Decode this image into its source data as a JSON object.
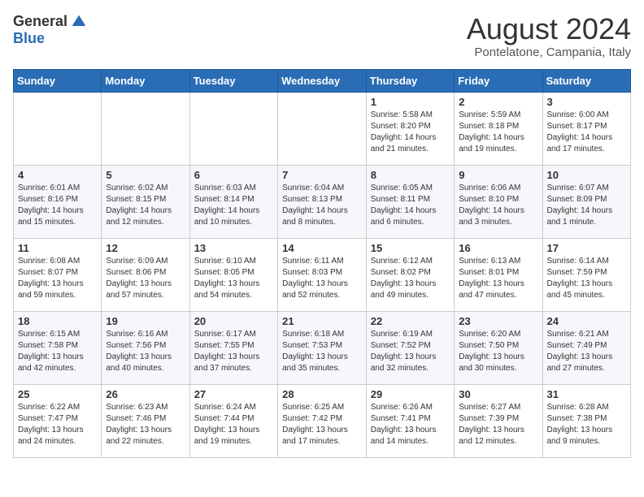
{
  "logo": {
    "general": "General",
    "blue": "Blue"
  },
  "title": "August 2024",
  "subtitle": "Pontelatone, Campania, Italy",
  "days_of_week": [
    "Sunday",
    "Monday",
    "Tuesday",
    "Wednesday",
    "Thursday",
    "Friday",
    "Saturday"
  ],
  "weeks": [
    [
      {
        "day": "",
        "info": ""
      },
      {
        "day": "",
        "info": ""
      },
      {
        "day": "",
        "info": ""
      },
      {
        "day": "",
        "info": ""
      },
      {
        "day": "1",
        "info": "Sunrise: 5:58 AM\nSunset: 8:20 PM\nDaylight: 14 hours\nand 21 minutes."
      },
      {
        "day": "2",
        "info": "Sunrise: 5:59 AM\nSunset: 8:18 PM\nDaylight: 14 hours\nand 19 minutes."
      },
      {
        "day": "3",
        "info": "Sunrise: 6:00 AM\nSunset: 8:17 PM\nDaylight: 14 hours\nand 17 minutes."
      }
    ],
    [
      {
        "day": "4",
        "info": "Sunrise: 6:01 AM\nSunset: 8:16 PM\nDaylight: 14 hours\nand 15 minutes."
      },
      {
        "day": "5",
        "info": "Sunrise: 6:02 AM\nSunset: 8:15 PM\nDaylight: 14 hours\nand 12 minutes."
      },
      {
        "day": "6",
        "info": "Sunrise: 6:03 AM\nSunset: 8:14 PM\nDaylight: 14 hours\nand 10 minutes."
      },
      {
        "day": "7",
        "info": "Sunrise: 6:04 AM\nSunset: 8:13 PM\nDaylight: 14 hours\nand 8 minutes."
      },
      {
        "day": "8",
        "info": "Sunrise: 6:05 AM\nSunset: 8:11 PM\nDaylight: 14 hours\nand 6 minutes."
      },
      {
        "day": "9",
        "info": "Sunrise: 6:06 AM\nSunset: 8:10 PM\nDaylight: 14 hours\nand 3 minutes."
      },
      {
        "day": "10",
        "info": "Sunrise: 6:07 AM\nSunset: 8:09 PM\nDaylight: 14 hours\nand 1 minute."
      }
    ],
    [
      {
        "day": "11",
        "info": "Sunrise: 6:08 AM\nSunset: 8:07 PM\nDaylight: 13 hours\nand 59 minutes."
      },
      {
        "day": "12",
        "info": "Sunrise: 6:09 AM\nSunset: 8:06 PM\nDaylight: 13 hours\nand 57 minutes."
      },
      {
        "day": "13",
        "info": "Sunrise: 6:10 AM\nSunset: 8:05 PM\nDaylight: 13 hours\nand 54 minutes."
      },
      {
        "day": "14",
        "info": "Sunrise: 6:11 AM\nSunset: 8:03 PM\nDaylight: 13 hours\nand 52 minutes."
      },
      {
        "day": "15",
        "info": "Sunrise: 6:12 AM\nSunset: 8:02 PM\nDaylight: 13 hours\nand 49 minutes."
      },
      {
        "day": "16",
        "info": "Sunrise: 6:13 AM\nSunset: 8:01 PM\nDaylight: 13 hours\nand 47 minutes."
      },
      {
        "day": "17",
        "info": "Sunrise: 6:14 AM\nSunset: 7:59 PM\nDaylight: 13 hours\nand 45 minutes."
      }
    ],
    [
      {
        "day": "18",
        "info": "Sunrise: 6:15 AM\nSunset: 7:58 PM\nDaylight: 13 hours\nand 42 minutes."
      },
      {
        "day": "19",
        "info": "Sunrise: 6:16 AM\nSunset: 7:56 PM\nDaylight: 13 hours\nand 40 minutes."
      },
      {
        "day": "20",
        "info": "Sunrise: 6:17 AM\nSunset: 7:55 PM\nDaylight: 13 hours\nand 37 minutes."
      },
      {
        "day": "21",
        "info": "Sunrise: 6:18 AM\nSunset: 7:53 PM\nDaylight: 13 hours\nand 35 minutes."
      },
      {
        "day": "22",
        "info": "Sunrise: 6:19 AM\nSunset: 7:52 PM\nDaylight: 13 hours\nand 32 minutes."
      },
      {
        "day": "23",
        "info": "Sunrise: 6:20 AM\nSunset: 7:50 PM\nDaylight: 13 hours\nand 30 minutes."
      },
      {
        "day": "24",
        "info": "Sunrise: 6:21 AM\nSunset: 7:49 PM\nDaylight: 13 hours\nand 27 minutes."
      }
    ],
    [
      {
        "day": "25",
        "info": "Sunrise: 6:22 AM\nSunset: 7:47 PM\nDaylight: 13 hours\nand 24 minutes."
      },
      {
        "day": "26",
        "info": "Sunrise: 6:23 AM\nSunset: 7:46 PM\nDaylight: 13 hours\nand 22 minutes."
      },
      {
        "day": "27",
        "info": "Sunrise: 6:24 AM\nSunset: 7:44 PM\nDaylight: 13 hours\nand 19 minutes."
      },
      {
        "day": "28",
        "info": "Sunrise: 6:25 AM\nSunset: 7:42 PM\nDaylight: 13 hours\nand 17 minutes."
      },
      {
        "day": "29",
        "info": "Sunrise: 6:26 AM\nSunset: 7:41 PM\nDaylight: 13 hours\nand 14 minutes."
      },
      {
        "day": "30",
        "info": "Sunrise: 6:27 AM\nSunset: 7:39 PM\nDaylight: 13 hours\nand 12 minutes."
      },
      {
        "day": "31",
        "info": "Sunrise: 6:28 AM\nSunset: 7:38 PM\nDaylight: 13 hours\nand 9 minutes."
      }
    ]
  ]
}
